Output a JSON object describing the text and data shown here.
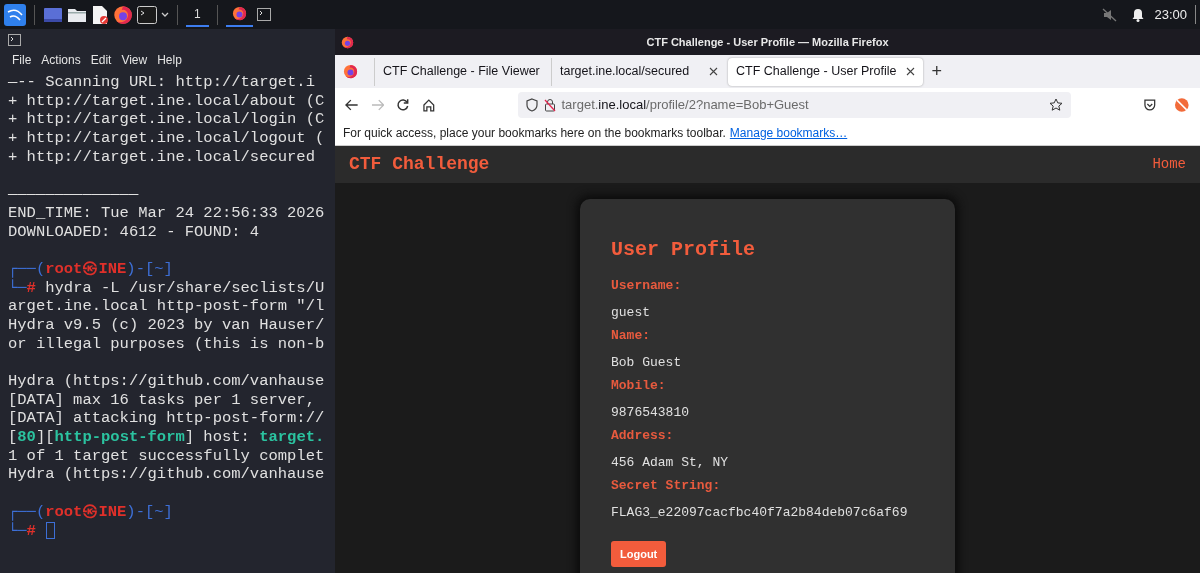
{
  "taskbar": {
    "workspace": "1",
    "clock": "23:00"
  },
  "terminal": {
    "menu": [
      "File",
      "Actions",
      "Edit",
      "View",
      "Help"
    ],
    "lines": [
      {
        "kind": "plain",
        "text": "—-- Scanning URL: http://target.i"
      },
      {
        "kind": "plain",
        "text": "+ http://target.ine.local/about (C"
      },
      {
        "kind": "plain",
        "text": "+ http://target.ine.local/login (C"
      },
      {
        "kind": "plain",
        "text": "+ http://target.ine.local/logout ("
      },
      {
        "kind": "plain",
        "text": "+ http://target.ine.local/secured"
      },
      {
        "kind": "blank"
      },
      {
        "kind": "plain",
        "text": "——————————————"
      },
      {
        "kind": "plain",
        "text": "END_TIME: Tue Mar 24 22:56:33 2026"
      },
      {
        "kind": "plain",
        "text": "DOWNLOADED: 4612 - FOUND: 4"
      },
      {
        "kind": "blank"
      },
      {
        "kind": "rich",
        "parts": [
          {
            "kind": "frame",
            "text": "┌──("
          },
          {
            "kind": "user",
            "text": "root㉿INE"
          },
          {
            "kind": "frame",
            "text": ")-[~]"
          }
        ]
      },
      {
        "kind": "rich",
        "parts": [
          {
            "kind": "frame",
            "text": "└─"
          },
          {
            "kind": "hash",
            "text": "#"
          },
          {
            "kind": "plain",
            "text": " hydra -L /usr/share/seclists/U"
          }
        ]
      },
      {
        "kind": "plain",
        "text": "arget.ine.local http-post-form \"/l"
      },
      {
        "kind": "plain",
        "text": "Hydra v9.5 (c) 2023 by van Hauser/"
      },
      {
        "kind": "plain",
        "text": "or illegal purposes (this is non-b"
      },
      {
        "kind": "blank"
      },
      {
        "kind": "plain",
        "text": "Hydra (https://github.com/vanhause"
      },
      {
        "kind": "plain",
        "text": "[DATA] max 16 tasks per 1 server,"
      },
      {
        "kind": "plain",
        "text": "[DATA] attacking http-post-form://"
      },
      {
        "kind": "rich",
        "parts": [
          {
            "kind": "plain",
            "text": "["
          },
          {
            "kind": "green",
            "text": "80"
          },
          {
            "kind": "plain",
            "text": "]["
          },
          {
            "kind": "green",
            "text": "http-post-form"
          },
          {
            "kind": "plain",
            "text": "] host: "
          },
          {
            "kind": "green",
            "text": "target."
          }
        ]
      },
      {
        "kind": "plain",
        "text": "1 of 1 target successfully complet"
      },
      {
        "kind": "plain",
        "text": "Hydra (https://github.com/vanhause"
      },
      {
        "kind": "blank"
      },
      {
        "kind": "rich",
        "parts": [
          {
            "kind": "frame",
            "text": "┌──("
          },
          {
            "kind": "user",
            "text": "root㉿INE"
          },
          {
            "kind": "frame",
            "text": ")-[~]"
          }
        ]
      },
      {
        "kind": "rich",
        "cursor": true,
        "parts": [
          {
            "kind": "frame",
            "text": "└─"
          },
          {
            "kind": "hash",
            "text": "#"
          }
        ]
      }
    ]
  },
  "browser": {
    "title": "CTF Challenge - User Profile — Mozilla Firefox",
    "tabs": [
      {
        "label": "CTF Challenge - File Viewer",
        "selected": false
      },
      {
        "label": "target.ine.local/secured",
        "selected": false
      },
      {
        "label": "CTF Challenge - User Profile",
        "selected": true
      }
    ],
    "new_tab": "+",
    "url": {
      "prefix": "target.",
      "host": "ine.local",
      "path": "/profile/2?name=Bob+Guest"
    },
    "bookmarks_hint": "For quick access, place your bookmarks here on the bookmarks toolbar.",
    "bookmarks_link": "Manage bookmarks…"
  },
  "page": {
    "brand": "CTF Challenge",
    "nav": [
      "Home"
    ],
    "heading": "User Profile",
    "fields": [
      {
        "label": "Username:",
        "value": "guest"
      },
      {
        "label": "Name:",
        "value": "Bob Guest"
      },
      {
        "label": "Mobile:",
        "value": "9876543810"
      },
      {
        "label": "Address:",
        "value": "456 Adam St, NY"
      },
      {
        "label": "Secret String:",
        "value": "FLAG3_e22097cacfbc40f7a2b84deb07c6af69"
      }
    ],
    "button": "Logout"
  }
}
